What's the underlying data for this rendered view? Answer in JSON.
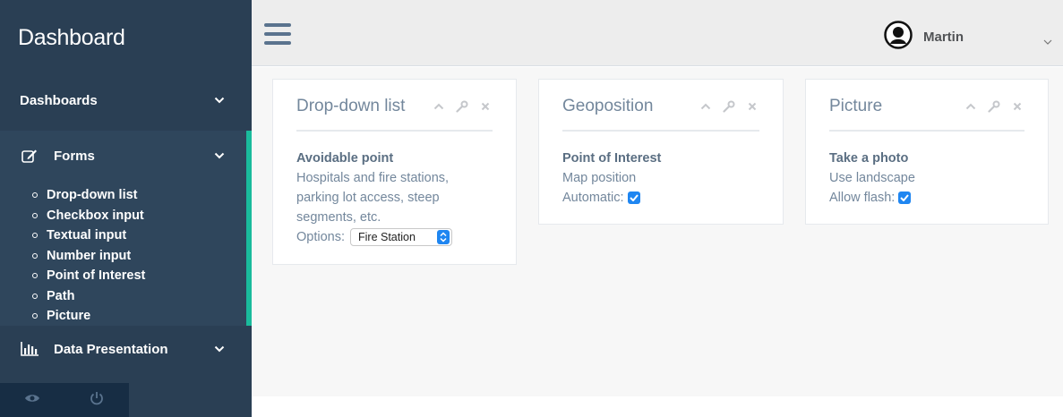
{
  "sidebar": {
    "title": "Dashboard",
    "nav": {
      "dashboards": "Dashboards",
      "forms": "Forms",
      "data_presentation": "Data Presentation"
    },
    "forms_items": [
      "Drop-down list",
      "Checkbox input",
      "Textual input",
      "Number input",
      "Point of Interest",
      "Path",
      "Picture"
    ],
    "accent_color": "#1abb9c"
  },
  "topbar": {
    "user_name": "Martin"
  },
  "panels": [
    {
      "title": "Drop-down list",
      "heading": "Avoidable point",
      "lines": [
        "Hospitals and fire stations,",
        "parking lot access, steep",
        "segments, etc."
      ],
      "options_label": "Options:",
      "options_value": "Fire Station"
    },
    {
      "title": "Geoposition",
      "heading": "Point of Interest",
      "line": "Map position",
      "checkbox_label": "Automatic:",
      "checked": true
    },
    {
      "title": "Picture",
      "heading": "Take a photo",
      "line": "Use landscape",
      "checkbox_label": "Allow flash:",
      "checked": true
    }
  ],
  "icons": {
    "panel_tools": [
      "chevron-up-icon",
      "wrench-icon",
      "close-icon"
    ],
    "footer": [
      "eye-icon",
      "power-icon"
    ]
  }
}
